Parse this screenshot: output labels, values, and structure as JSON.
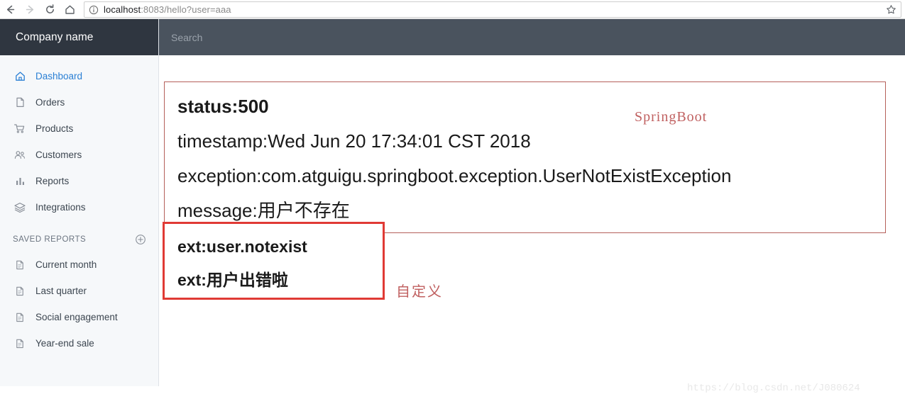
{
  "browser": {
    "back_icon": "arrow-left-icon",
    "forward_icon": "arrow-right-icon",
    "reload_icon": "reload-icon",
    "home_icon": "home-icon",
    "info_icon": "page-info-icon",
    "star_icon": "bookmark-star-icon",
    "url_host": "localhost",
    "url_rest": ":8083/hello?user=aaa"
  },
  "sidebar": {
    "brand": "Company name",
    "items": [
      {
        "label": "Dashboard",
        "icon": "home-icon",
        "active": true
      },
      {
        "label": "Orders",
        "icon": "file-icon",
        "active": false
      },
      {
        "label": "Products",
        "icon": "cart-icon",
        "active": false
      },
      {
        "label": "Customers",
        "icon": "people-icon",
        "active": false
      },
      {
        "label": "Reports",
        "icon": "bar-chart-icon",
        "active": false
      },
      {
        "label": "Integrations",
        "icon": "layers-icon",
        "active": false
      }
    ],
    "saved_reports_title": "SAVED REPORTS",
    "add_report_icon": "plus-circle-icon",
    "saved_reports": [
      {
        "label": "Current month",
        "icon": "file-icon"
      },
      {
        "label": "Last quarter",
        "icon": "file-icon"
      },
      {
        "label": "Social engagement",
        "icon": "file-icon"
      },
      {
        "label": "Year-end sale",
        "icon": "file-icon"
      }
    ]
  },
  "topbar": {
    "search_placeholder": "Search",
    "search_value": ""
  },
  "content": {
    "error_box": {
      "status": "status:500",
      "timestamp": "timestamp:Wed Jun 20 17:34:01 CST 2018",
      "exception": "exception:com.atguigu.springboot.exception.UserNotExistException",
      "message": "message:用户不存在"
    },
    "ext_box": {
      "line1": "ext:user.notexist",
      "line2": "ext:用户出错啦"
    },
    "annotations": {
      "springboot": "SpringBoot",
      "custom": "自定义"
    },
    "watermark": "https://blog.csdn.net/J080624"
  },
  "colors": {
    "brand_bar": "#2f3640",
    "topbar": "#4a535e",
    "sidebar_bg": "#f6f8fa",
    "active_nav": "#2a7fd4",
    "error_box_border": "#b5605a",
    "ext_box_border": "#e03a35",
    "annotation_red": "#c06060"
  }
}
